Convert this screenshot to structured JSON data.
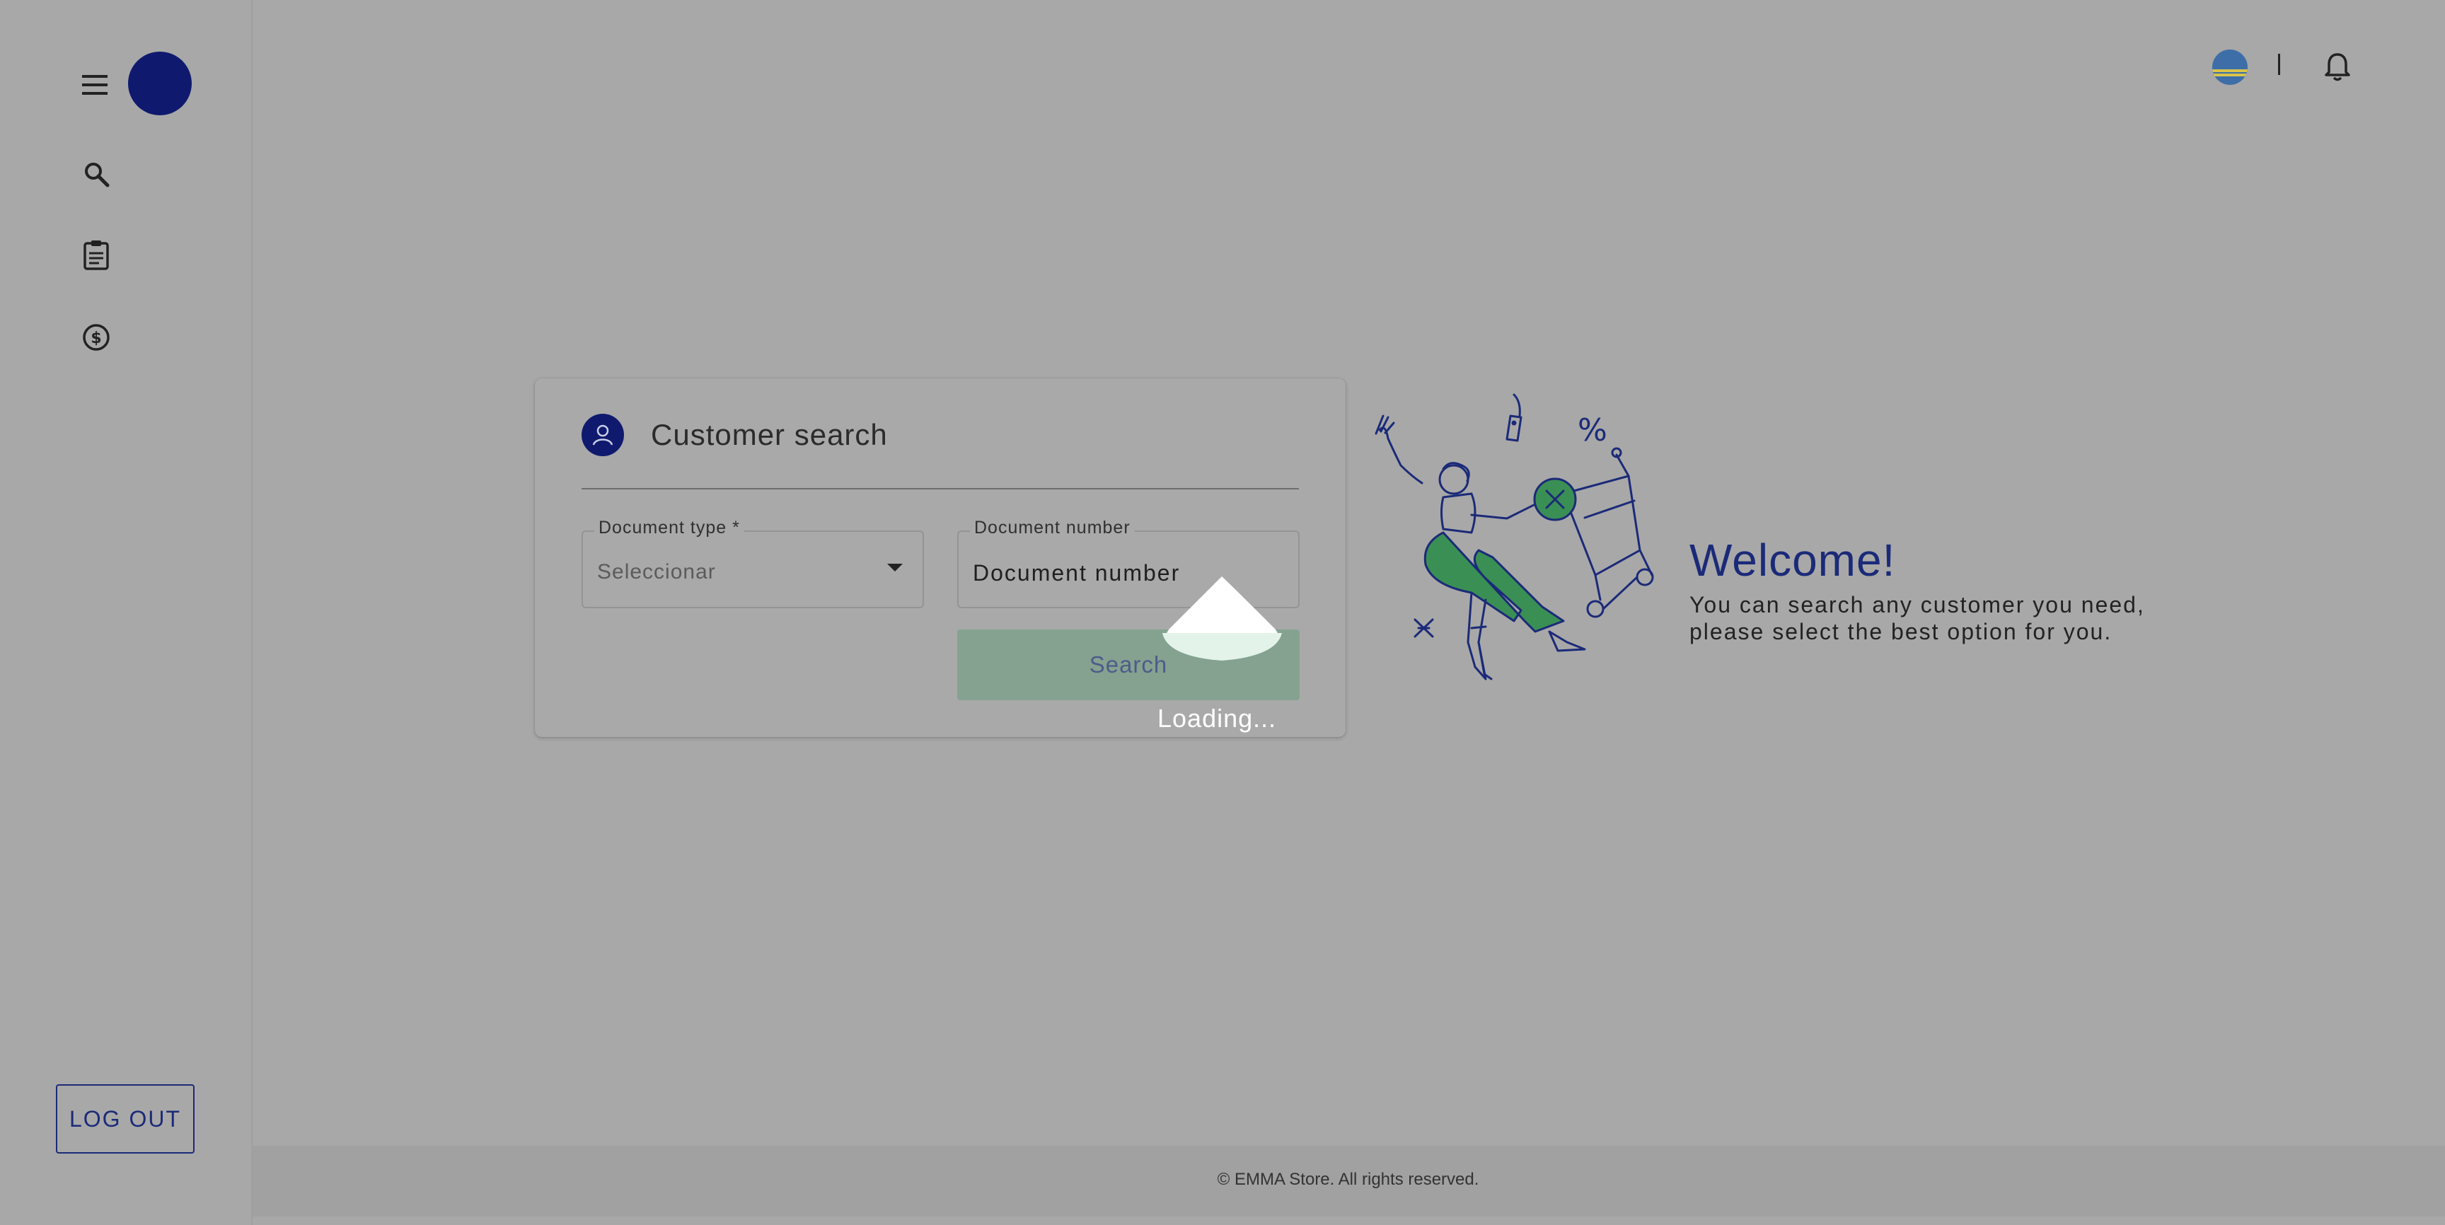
{
  "sidebar": {
    "menu_icon": "menu-icon",
    "nav": [
      {
        "icon": "search-icon"
      },
      {
        "icon": "clipboard-icon"
      },
      {
        "icon": "dollar-icon"
      }
    ],
    "logout_label": "LOG OUT"
  },
  "topbar": {
    "flag_icon": "flag-icon",
    "separator": "|",
    "bell_icon": "bell-icon"
  },
  "card": {
    "title": "Customer search",
    "document_type": {
      "label": "Document type *",
      "placeholder": "Seleccionar"
    },
    "document_number": {
      "label": "Document number",
      "value": "Document number"
    },
    "search_label": "Search"
  },
  "loading": {
    "text": "Loading..."
  },
  "welcome": {
    "title": "Welcome!",
    "line1": "You can search any customer you need,",
    "line2": "please select the best option for you."
  },
  "footer": {
    "text": "© EMMA Store. All rights reserved."
  },
  "colors": {
    "brand": "#0f1a6e",
    "accent": "#3a8f55",
    "button": "#85a290",
    "overlay": "#a8a8a8"
  }
}
